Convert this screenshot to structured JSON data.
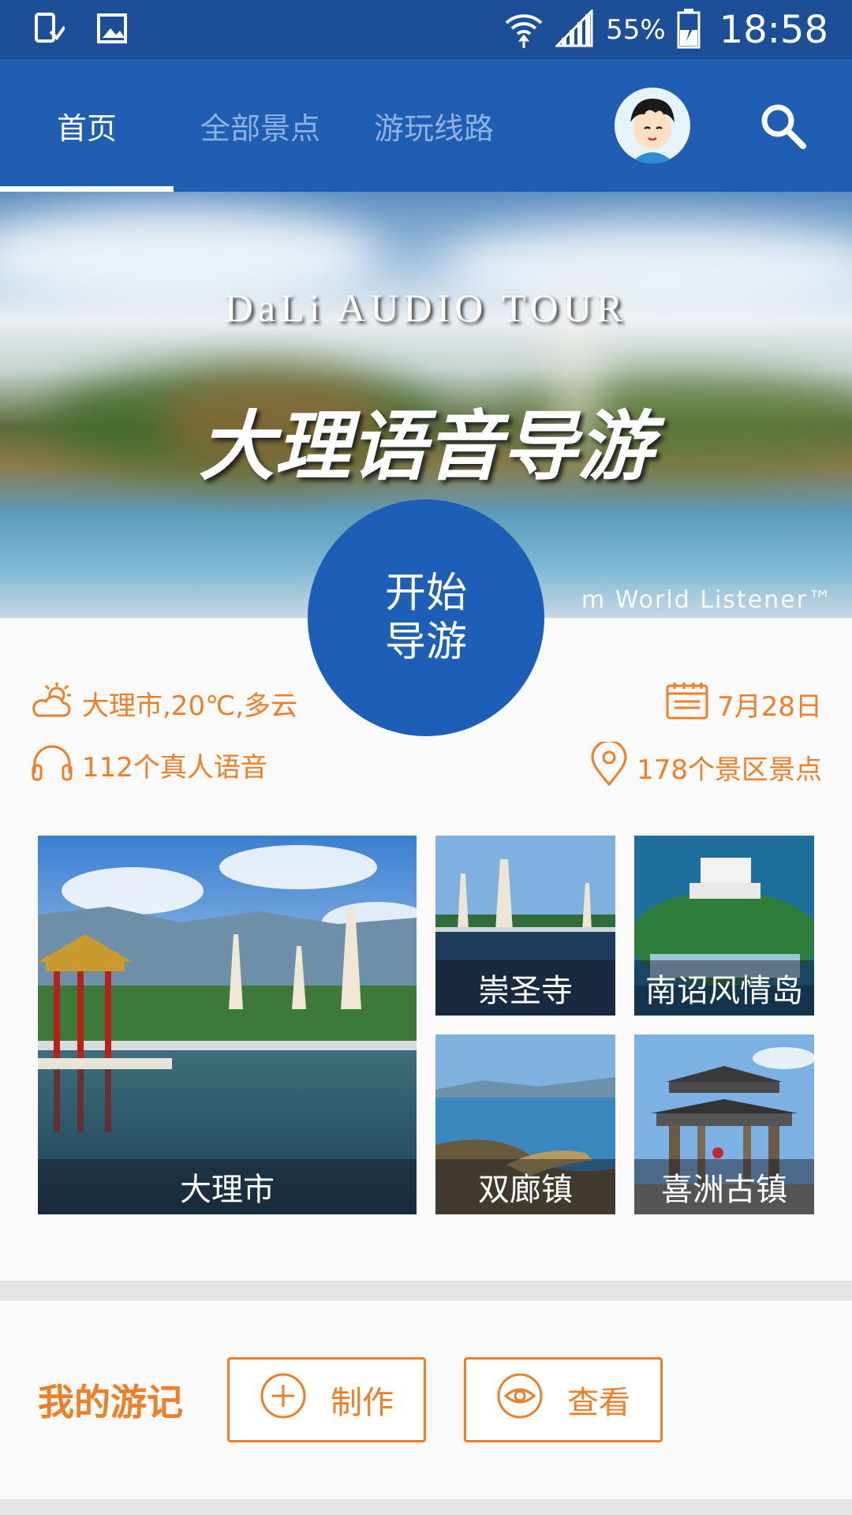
{
  "status_bar": {
    "battery_percent": "55%",
    "time": "18:58",
    "icons": [
      "device-download-icon",
      "image-icon",
      "wifi-icon",
      "signal-icon",
      "battery-charging-icon"
    ]
  },
  "tabs": [
    {
      "label": "首页",
      "active": true
    },
    {
      "label": "全部景点",
      "active": false
    },
    {
      "label": "游玩线路",
      "active": false
    }
  ],
  "banner": {
    "subtitle": "DaLi AUDIO TOUR",
    "title": "大理语音导游",
    "credit": "m World Listener™"
  },
  "start_button": {
    "line1": "开始",
    "line2": "导游"
  },
  "info": {
    "weather": "大理市,20℃,多云",
    "date": "7月28日",
    "voices": "112个真人语音",
    "spots": "178个景区景点"
  },
  "destinations": [
    {
      "label": "大理市"
    },
    {
      "label": "崇圣寺"
    },
    {
      "label": "南诏风情岛"
    },
    {
      "label": "双廊镇"
    },
    {
      "label": "喜洲古镇"
    }
  ],
  "travel_notes": {
    "title": "我的游记",
    "create_label": "制作",
    "view_label": "查看"
  },
  "colors": {
    "primary_blue": "#1f5eb3",
    "status_blue": "#1c4f98",
    "accent_orange": "#ef7f26"
  }
}
